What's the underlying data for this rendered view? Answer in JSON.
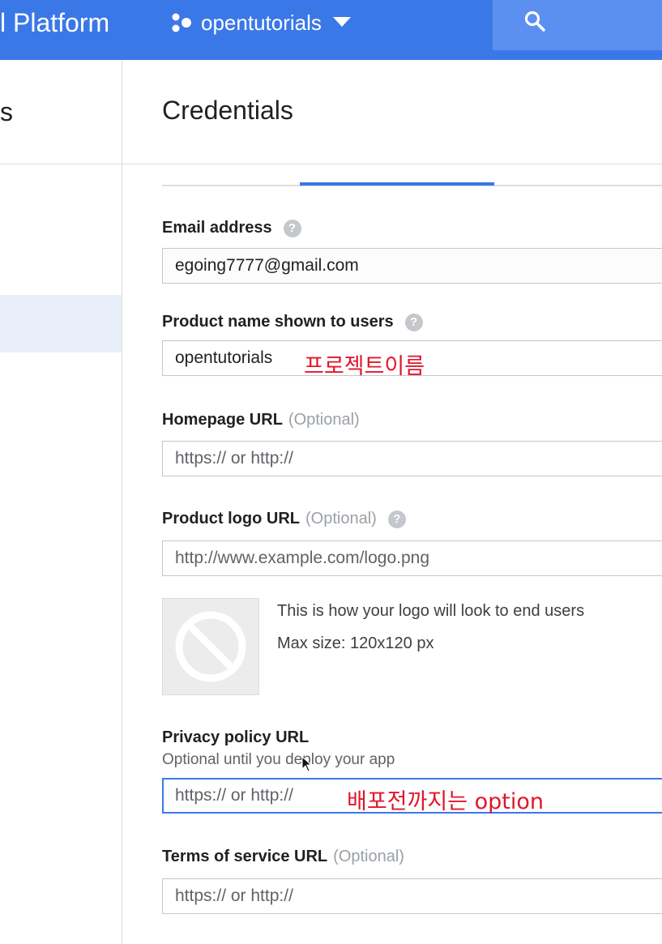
{
  "topbar": {
    "brand": "l Platform",
    "project_name": "opentutorials",
    "icons": {
      "project": "project-dots-icon",
      "caret": "caret-down-icon",
      "search": "search-icon"
    },
    "colors": {
      "bar": "#3b78e7",
      "search_bg": "#5b8ff0"
    }
  },
  "sidebar": {
    "title_fragment": "s"
  },
  "main": {
    "title": "Credentials",
    "fields": {
      "email": {
        "label": "Email address",
        "value": "egoing7777@gmail.com"
      },
      "product_name": {
        "label": "Product name shown to users",
        "value": "opentutorials"
      },
      "homepage": {
        "label": "Homepage URL",
        "optional": "(Optional)",
        "placeholder": "https:// or http://"
      },
      "logo": {
        "label": "Product logo URL",
        "optional": "(Optional)",
        "placeholder": "http://www.example.com/logo.png",
        "preview_line1": "This is how your logo will look to end users",
        "preview_line2": "Max size: 120x120 px",
        "preview_icon": "no-image-icon"
      },
      "privacy": {
        "label": "Privacy policy URL",
        "hint": "Optional until you deploy your app",
        "placeholder": "https:// or http://"
      },
      "terms": {
        "label": "Terms of service URL",
        "optional": "(Optional)",
        "placeholder": "https:// or http://"
      }
    }
  },
  "annotations": {
    "product_name_note": "프로젝트이름",
    "privacy_note": "배포전까지는 option",
    "color": "#e0162b"
  }
}
